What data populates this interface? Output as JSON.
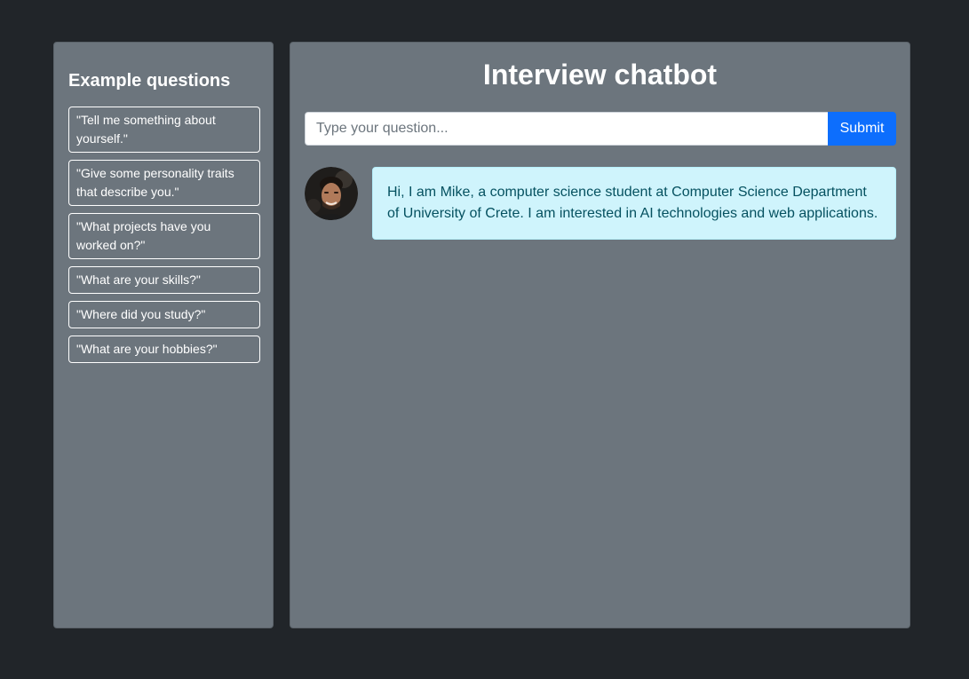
{
  "sidebar": {
    "title": "Example questions",
    "questions": [
      "\"Tell me something about yourself.\"",
      "\"Give some personality traits that describe you.\"",
      "\"What projects have you worked on?\"",
      "\"What are your skills?\"",
      "\"Where did you study?\"",
      "\"What are your hobbies?\""
    ]
  },
  "main": {
    "title": "Interview chatbot",
    "input": {
      "placeholder": "Type your question...",
      "value": ""
    },
    "submit_label": "Submit",
    "messages": [
      {
        "sender": "bot",
        "avatar": "person-avatar",
        "text": "Hi, I am Mike, a computer science student at Computer Science Department of University of Crete. I am interested in AI technologies and web applications."
      }
    ]
  },
  "colors": {
    "page_background": "#212529",
    "panel_background": "#6c757d",
    "accent": "#0d6efd",
    "bubble_background": "#cff4fc",
    "bubble_text": "#055160"
  }
}
